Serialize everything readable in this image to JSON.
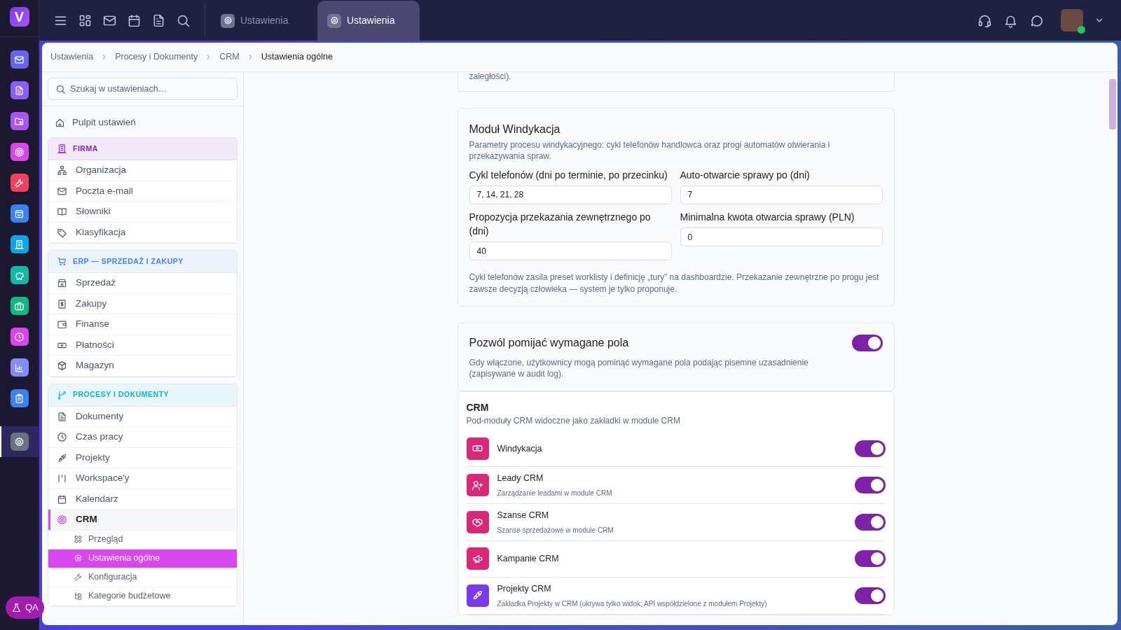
{
  "rail": {
    "logo": "V",
    "items": [
      {
        "color": "#6366f1",
        "selected": false
      },
      {
        "color": "#8b5cf6",
        "selected": false
      },
      {
        "color": "#a855f7",
        "selected": false
      },
      {
        "color": "#d946ef",
        "selected": false
      },
      {
        "color": "#f43f5e",
        "selected": false
      },
      {
        "color": "#3b82f6",
        "selected": false
      },
      {
        "color": "#0ea5e9",
        "selected": false
      },
      {
        "color": "#14b8a6",
        "selected": false
      },
      {
        "color": "#10b981",
        "selected": false
      },
      {
        "color": "#d946ef",
        "selected": false
      },
      {
        "color": "#818cf8",
        "selected": false
      },
      {
        "color": "#3b82f6",
        "selected": false
      },
      {
        "color": "#6b7280",
        "selected": true
      }
    ]
  },
  "topbar": {
    "tabs": [
      {
        "label": "Ustawienia",
        "selected": false
      },
      {
        "label": "Ustawienia",
        "selected": true
      }
    ],
    "user": {
      "online": true
    }
  },
  "breadcrumb": [
    "Ustawienia",
    "Procesy i Dokumenty",
    "CRM",
    "Ustawienia ogólne"
  ],
  "sidebar": {
    "search": {
      "placeholder": "Szukaj w ustawieniach…"
    },
    "home": "Pulpit ustawień",
    "sections": [
      {
        "title": "FIRMA",
        "color": "#7e22ce",
        "items": [
          {
            "label": "Organizacja",
            "selected": false
          },
          {
            "label": "Poczta e-mail",
            "selected": false
          },
          {
            "label": "Słowniki",
            "selected": false
          },
          {
            "label": "Klasyfikacja",
            "selected": false
          }
        ]
      },
      {
        "title": "ERP — SPRZEDAŻ I ZAKUPY",
        "color": "#3b82f6",
        "items": [
          {
            "label": "Sprzedaż",
            "selected": false
          },
          {
            "label": "Zakupy",
            "selected": false
          },
          {
            "label": "Finanse",
            "selected": false
          },
          {
            "label": "Płatności",
            "selected": false
          },
          {
            "label": "Magazyn",
            "selected": false
          }
        ]
      },
      {
        "title": "PROCESY I DOKUMENTY",
        "color": "#06b6d4",
        "items": [
          {
            "label": "Dokumenty",
            "selected": false
          },
          {
            "label": "Czas pracy",
            "selected": false
          },
          {
            "label": "Projekty",
            "selected": false
          },
          {
            "label": "Workspace'y",
            "selected": false
          },
          {
            "label": "Kalendarz",
            "selected": false
          },
          {
            "label": "CRM",
            "selected": false,
            "expanded": true,
            "children": [
              {
                "label": "Przegląd",
                "selected": false
              },
              {
                "label": "Ustawienia ogólne",
                "selected": true
              },
              {
                "label": "Konfiguracja",
                "selected": false
              },
              {
                "label": "Kategorie budżetowe",
                "selected": false
              }
            ]
          }
        ]
      }
    ]
  },
  "content": {
    "top_fragment": "zaległości).",
    "collection": {
      "title": "Moduł Windykacja",
      "description": "Parametry procesu windykacyjnego: cykl telefonów handlowca oraz progi automatów otwierania i przekazywania spraw.",
      "fields": [
        {
          "label": "Cykl telefonów (dni po terminie, po przecinku)",
          "value": "7, 14, 21, 28"
        },
        {
          "label": "Auto-otwarcie sprawy po (dni)",
          "value": "7"
        },
        {
          "label": "Propozycja przekazania zewnętrznego po (dni)",
          "value": "40"
        },
        {
          "label": "Minimalna kwota otwarcia sprawy (PLN)",
          "value": "0"
        }
      ],
      "note": "Cykl telefonów zasila preset worklisty i definicję „tury” na dashboardzie. Przekazanie zewnętrzne po progu jest zawsze decyzją człowieka — system je tylko proponuje."
    },
    "skip_required": {
      "title": "Pozwól pomijać wymagane pola",
      "description": "Gdy włączone, użytkownicy mogą pominąć wymagane pola podając pisemne uzasadnienie (zapisywane w audit log).",
      "on": true
    },
    "crm": {
      "title": "CRM",
      "description": "Pod-moduły CRM widoczne jako zakładki w module CRM",
      "modules": [
        {
          "name": "Windykacja",
          "color": "#db2777",
          "on": true
        },
        {
          "name": "Leady CRM",
          "description": "Zarządzanie leadami w module CRM",
          "color": "#db2777",
          "on": true
        },
        {
          "name": "Szanse CRM",
          "description": "Szanse sprzedażowe w module CRM",
          "color": "#db2777",
          "on": true
        },
        {
          "name": "Kampanie CRM",
          "color": "#db2777",
          "on": true
        },
        {
          "name": "Projekty CRM",
          "description": "Zakładka Projekty w CRM (ukrywa tylko widok; API współdzielone z modułem Projekty)",
          "color": "#7c3aed",
          "on": true
        }
      ]
    }
  },
  "qa_button": {
    "label": "QA"
  }
}
